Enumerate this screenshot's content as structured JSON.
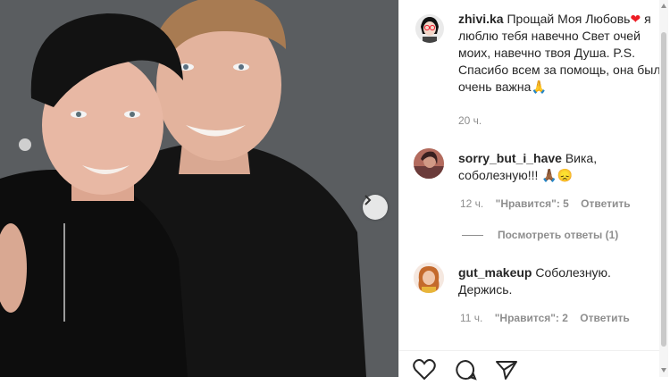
{
  "post": {
    "image_alt": "Photo of a couple embracing",
    "next_icon": "chevron-right-icon"
  },
  "caption": {
    "username": "zhivi.ka",
    "text_1": "Прощай Моя Любовь",
    "text_2": "я люблю тебя навечно Свет очей моих, навечно твоя Душа. P.S. Спасибо всем за помощь, она был очень важна",
    "emoji_heart": "❤",
    "emoji_pray": "🙏",
    "time": "20 ч."
  },
  "comments": [
    {
      "username": "sorry_but_i_have",
      "text": "Вика, соболезную!!! 🙏🏾😞",
      "time": "12 ч.",
      "likes": "\"Нравится\": 5",
      "reply": "Ответить",
      "view_replies": "Посмотреть ответы (1)"
    },
    {
      "username": "gut_makeup",
      "text": "Соболезную. Держись.",
      "time": "11 ч.",
      "likes": "\"Нравится\": 2",
      "reply": "Ответить"
    }
  ],
  "colors": {
    "text": "#262626",
    "muted": "#8e8e8e",
    "heart": "#ed1c24"
  }
}
